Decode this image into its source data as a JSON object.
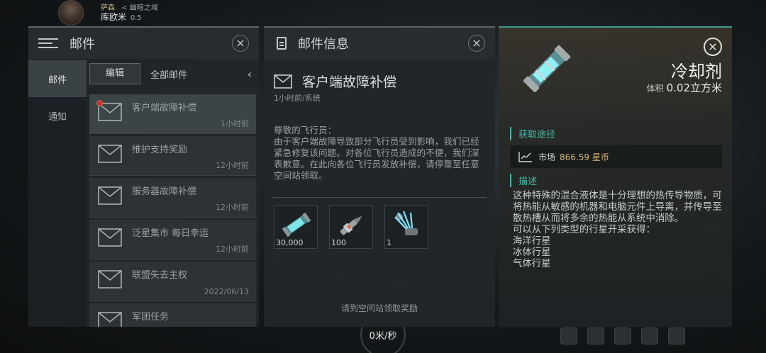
{
  "hud": {
    "region": "萨森",
    "location": "< 幽暗之域",
    "pilot_name": "库欧米",
    "security": "0.5",
    "speed": "0米/秒"
  },
  "mail_panel": {
    "title": "邮件",
    "close": "×",
    "side_nav": [
      "邮件",
      "通知"
    ],
    "edit_label": "编辑",
    "filter_label": "全部邮件",
    "collapse": "‹",
    "items": [
      {
        "title": "客户端故障补偿",
        "time": "1小时前",
        "unread": true,
        "selected": true
      },
      {
        "title": "维护支持奖励",
        "time": "12小时前",
        "unread": false,
        "selected": false
      },
      {
        "title": "服务器故障补偿",
        "time": "12小时前",
        "unread": false,
        "selected": false
      },
      {
        "title": "泛星集市 每日幸运",
        "time": "12小时前",
        "unread": false,
        "selected": false
      },
      {
        "title": "联盟失去主权",
        "time": "2022/06/13",
        "unread": false,
        "selected": false
      },
      {
        "title": "军团任务",
        "time": "",
        "unread": false,
        "selected": false
      }
    ]
  },
  "detail_panel": {
    "title": "邮件信息",
    "close": "×",
    "subject": "客户端故障补偿",
    "meta": "1小时前/系统",
    "greeting": "尊敬的飞行员：",
    "body": "由于客户端故障导致部分飞行员受到影响，我们已经紧急修复该问题。对各位飞行员造成的不便，我们深表歉意。在此向各位飞行员发放补偿，请停靠至任意空间站领取。",
    "attachments": [
      {
        "icon": "coolant-canister-icon",
        "qty": "30,000"
      },
      {
        "icon": "drill-module-icon",
        "qty": "100"
      },
      {
        "icon": "energy-claw-icon",
        "qty": "1"
      }
    ],
    "footer_note": "请到空间站领取奖励"
  },
  "item_panel": {
    "name": "冷却剂",
    "volume_label": "体积",
    "volume_value": "0.02立方米",
    "source_heading": "获取途径",
    "market_label": "市场",
    "market_price": "866.59 星币",
    "desc_heading": "描述",
    "description": "这种特殊的混合液体是十分理想的热传导物质，可将热能从敏感的机器和电脑元件上导离，并传导至散热槽从而将多余的热能从系统中消除。",
    "source_intro": "可以从下列类型的行星开采获得：",
    "planets": [
      "海洋行星",
      "冰体行星",
      "气体行星"
    ],
    "close": "×"
  }
}
